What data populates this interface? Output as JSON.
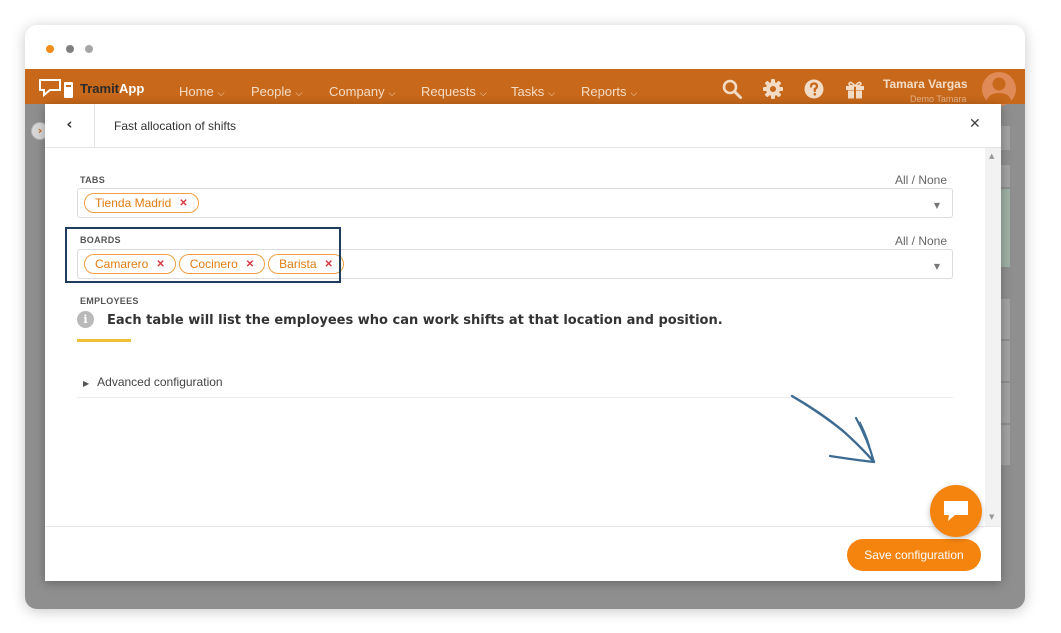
{
  "app": {
    "logo": {
      "part1": "Tramit",
      "part2": "App"
    },
    "nav": [
      {
        "label": "Home"
      },
      {
        "label": "People"
      },
      {
        "label": "Company"
      },
      {
        "label": "Requests"
      },
      {
        "label": "Tasks"
      },
      {
        "label": "Reports"
      }
    ],
    "icons": [
      "search-icon",
      "gear-icon",
      "help-icon",
      "gift-icon"
    ],
    "user": {
      "name": "Tamara Vargas",
      "subtitle": "Demo Tamara"
    },
    "colors": {
      "navbar": "#c8681a",
      "accent": "#f5840f",
      "chip_border": "#f0a042",
      "chip_remove": "#d9363e",
      "highlight": "#1e3d5c"
    }
  },
  "modal": {
    "title": "Fast allocation of shifts",
    "tabs": {
      "label": "TABS",
      "all_none": "All / None",
      "chips": [
        "Tienda Madrid"
      ]
    },
    "boards": {
      "label": "BOARDS",
      "all_none": "All / None",
      "chips": [
        "Camarero",
        "Cocinero",
        "Barista"
      ]
    },
    "employees": {
      "label": "EMPLOYEES",
      "info": "Each table will list the employees who can work shifts at that location and position."
    },
    "advanced": "Advanced configuration",
    "save": "Save configuration"
  }
}
